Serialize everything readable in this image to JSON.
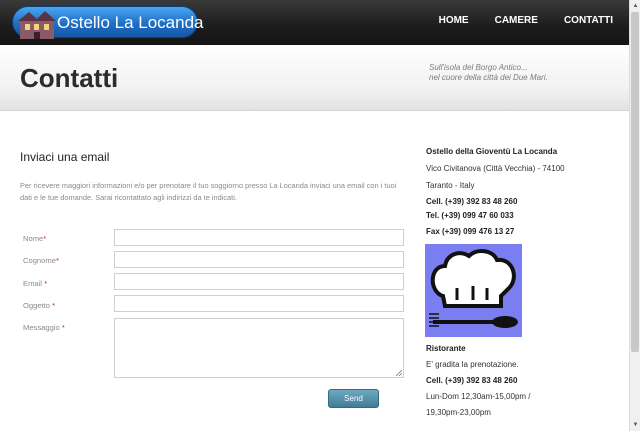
{
  "header": {
    "logo_text": "Ostello La Locanda",
    "nav": [
      "HOME",
      "CAMERE",
      "CONTATTI"
    ]
  },
  "band": {
    "title": "Contatti",
    "tagline_1": "Sull'isola del Borgo Antico...",
    "tagline_2": "nel cuore della città dei Due Mari."
  },
  "form": {
    "title": "Inviaci una email",
    "intro": "Per ricevere maggiori informazioni e/o per prenotare il tuo soggiorno presso La Locanda inviaci una email con i tuoi dati e le tue domande. Sarai ricontattato agli indirizzi da te indicati.",
    "fields": {
      "nome": "Nome",
      "cognome": "Cognome",
      "email": "Email",
      "oggetto": "Oggetto",
      "messaggio": "Messaggio"
    },
    "required_mark": "*",
    "send_label": "Send"
  },
  "contact": {
    "name": "Ostello della Gioventù La Locanda",
    "address_1": "Vico Civitanova (Città Vecchia) - 74100",
    "address_2": "Taranto - Italy",
    "cell": "Cell. (+39) 392 83 48 260",
    "tel": "Tel. (+39) 099 47 60 033",
    "fax": "Fax (+39) 099 476 13 27"
  },
  "restaurant": {
    "title": "Ristorante",
    "note": "E' gradita la prenotazione.",
    "cell": "Cell. (+39) 392 83 48 260",
    "hours_1": "Lun-Dom 12,30am-15,00pm /",
    "hours_2": "19,30pm-23,00pm"
  },
  "colors": {
    "logo_blue": "#1f6fc6",
    "chef_bg": "#7a7ef0",
    "send_button": "#3f7d97"
  },
  "icons": {
    "logo": "house-icon",
    "chef": "chef-hat-cutlery-icon"
  }
}
